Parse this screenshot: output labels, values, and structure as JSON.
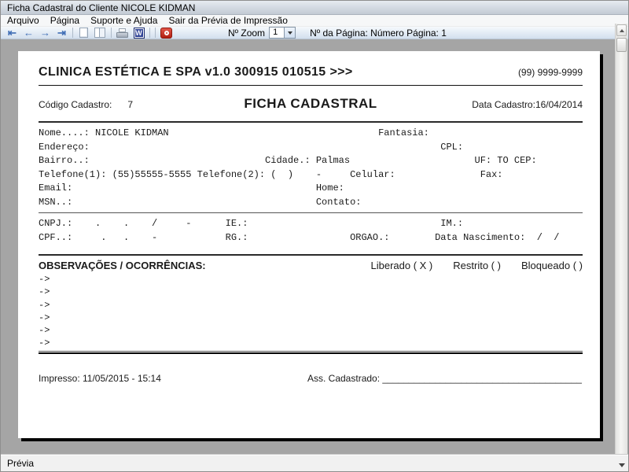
{
  "window": {
    "title": "Ficha Cadastral do Cliente NICOLE KIDMAN",
    "status": "Prévia"
  },
  "menu": {
    "items": [
      "Arquivo",
      "Página",
      "Suporte e Ajuda",
      "Sair da Prévia de Impressão"
    ]
  },
  "toolbar": {
    "icons": [
      "first-page",
      "previous-page",
      "next-page",
      "last-page",
      "single-page-view",
      "two-page-view",
      "print",
      "export-word",
      "close-preview"
    ],
    "nav_glyphs": [
      "⇤",
      "←",
      "→",
      "⇥"
    ],
    "word_glyph": "W",
    "zoom_label": "Nº Zoom",
    "zoom_value": "1",
    "page_label": "Nº da Página: Número Página: 1"
  },
  "document": {
    "company_header": "CLINICA ESTÉTICA E SPA v1.0 300915 010515 >>>",
    "phone": "(99) 9999-9999",
    "codigo_label": "Código Cadastro:",
    "codigo_value": "7",
    "form_title": "FICHA CADASTRAL",
    "data_cadastro": "Data Cadastro:16/04/2014",
    "mono_lines": {
      "0": "Nome....: NICOLE KIDMAN                                     Fantasia:",
      "1": "Endereço:                                                              CPL:",
      "2": "Bairro..:                               Cidade.: Palmas                      UF: TO CEP:",
      "3": "Telefone(1): (55)55555-5555 Telefone(2): (  )    -     Celular:               Fax:",
      "4": "Email:                                           Home:",
      "5": "MSN..:                                           Contato:"
    },
    "mono_lines2": {
      "0": "CNPJ.:    .    .    /     -      IE.:                                  IM.:",
      "1": "CPF..:     .   .    -            RG.:                  ORGAO.:        Data Nascimento:  /  /"
    },
    "observacoes_label": "OBSERVAÇÕES / OCORRÊNCIAS:",
    "flags": {
      "0": "Liberado ( X )",
      "1": "Restrito (  )",
      "2": "Bloqueado (  )"
    },
    "arrow_lines": "->\n->\n->\n->\n->\n->",
    "impresso": "Impresso: 11/05/2015 - 15:14",
    "assinatura": "Ass. Cadastrado: ______________________________________"
  }
}
